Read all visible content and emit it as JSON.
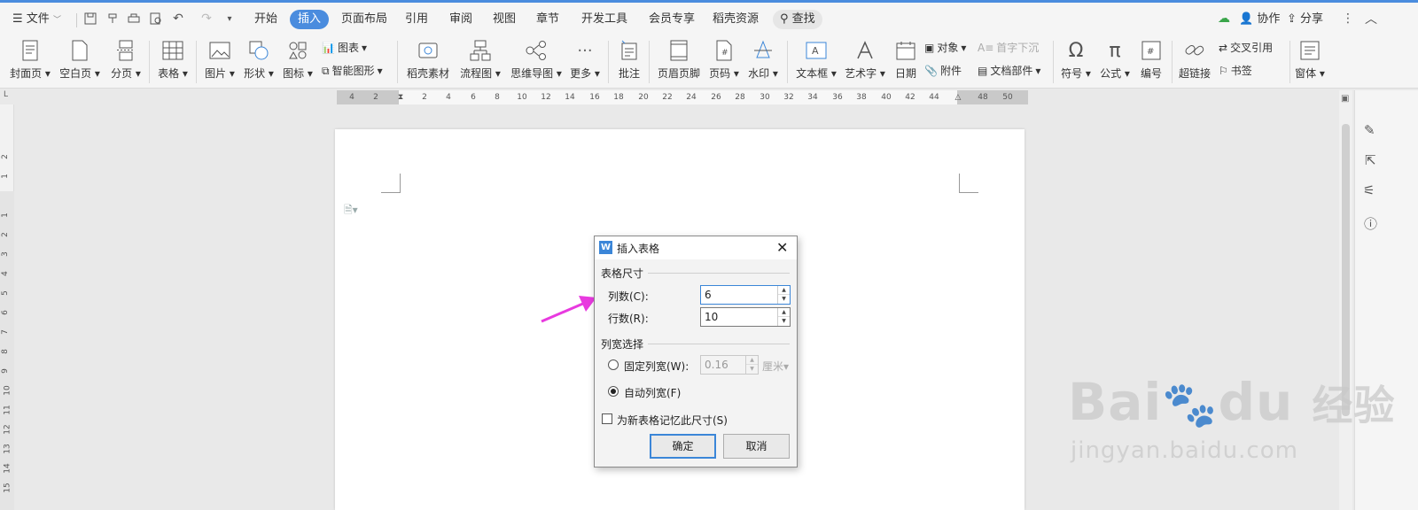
{
  "menubar": {
    "file": "文件",
    "tabs": [
      "开始",
      "插入",
      "页面布局",
      "引用",
      "审阅",
      "视图",
      "章节",
      "开发工具",
      "会员专享",
      "稻壳资源"
    ],
    "search": "查找",
    "collab": "协作",
    "share": "分享"
  },
  "ribbon": {
    "cover": "封面页",
    "blank": "空白页",
    "pagebreak": "分页",
    "table": "表格",
    "picture": "图片",
    "shape": "形状",
    "icon": "图标",
    "chart": "图表",
    "smartart": "智能图形",
    "docer": "稻壳素材",
    "flowchart": "流程图",
    "mindmap": "思维导图",
    "more": "更多",
    "comment": "批注",
    "headerfooter": "页眉页脚",
    "pagenum": "页码",
    "watermark": "水印",
    "textbox": "文本框",
    "wordart": "艺术字",
    "date": "日期",
    "object": "对象",
    "dropcap": "首字下沉",
    "attachment": "附件",
    "docparts": "文档部件",
    "symbol": "符号",
    "formula": "公式",
    "numbering": "编号",
    "hyperlink": "超链接",
    "crossref": "交叉引用",
    "bookmark": "书签",
    "window": "窗体"
  },
  "ruler": {
    "h_ticks": [
      "4",
      "2",
      "2",
      "4",
      "6",
      "8",
      "10",
      "12",
      "14",
      "16",
      "18",
      "20",
      "22",
      "24",
      "26",
      "28",
      "30",
      "32",
      "34",
      "36",
      "38",
      "40",
      "42",
      "44",
      "48",
      "50"
    ],
    "v_ticks": [
      "2",
      "1",
      "1",
      "2",
      "3",
      "4",
      "5",
      "6",
      "7",
      "8",
      "9",
      "10",
      "11",
      "12",
      "13",
      "14",
      "15"
    ],
    "corner": "L"
  },
  "dialog": {
    "title": "插入表格",
    "group_size": "表格尺寸",
    "cols_label": "列数(C):",
    "cols_value": "6",
    "rows_label": "行数(R):",
    "rows_value": "10",
    "group_width": "列宽选择",
    "fixed_label": "固定列宽(W):",
    "fixed_value": "0.16",
    "fixed_unit": "厘米",
    "auto_label": "自动列宽(F)",
    "remember_label": "为新表格记忆此尺寸(S)",
    "ok": "确定",
    "cancel": "取消"
  },
  "watermark": {
    "brand": "Bai",
    "brand2": "du",
    "cn": "经验",
    "url": "jingyan.baidu.com"
  },
  "colors": {
    "accent": "#4a8cde",
    "arrow": "#e83adf"
  }
}
